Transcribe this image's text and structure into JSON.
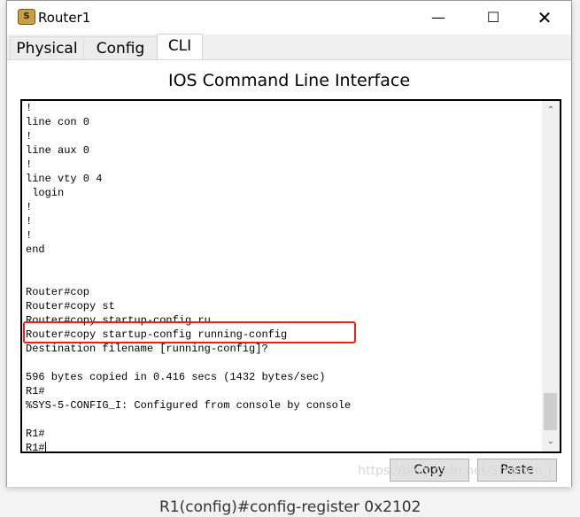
{
  "window": {
    "title": "Router1",
    "icon": "router-app-icon",
    "controls": [
      "minimize",
      "maximize",
      "close"
    ]
  },
  "tabs": [
    {
      "label": "Physical"
    },
    {
      "label": "Config"
    },
    {
      "label": "CLI",
      "active": true
    }
  ],
  "heading": "IOS Command Line Interface",
  "terminal_lines": [
    "!",
    "line con 0",
    "!",
    "line aux 0",
    "!",
    "line vty 0 4",
    " login",
    "!",
    "!",
    "!",
    "end",
    "",
    "",
    "Router#cop",
    "Router#copy st",
    "Router#copy startup-config ru",
    "Router#copy startup-config running-config",
    "Destination filename [running-config]?",
    "",
    "596 bytes copied in 0.416 secs (1432 bytes/sec)",
    "R1#",
    "%SYS-5-CONFIG_I: Configured from console by console",
    "",
    "R1#",
    "R1#"
  ],
  "highlight_color": "#e5231b",
  "buttons": {
    "copy": "Copy",
    "paste": "Paste"
  },
  "watermark": "https://blog.csdn.net/Stephen_j",
  "background_text": "R1(config)#config-register 0x2102"
}
